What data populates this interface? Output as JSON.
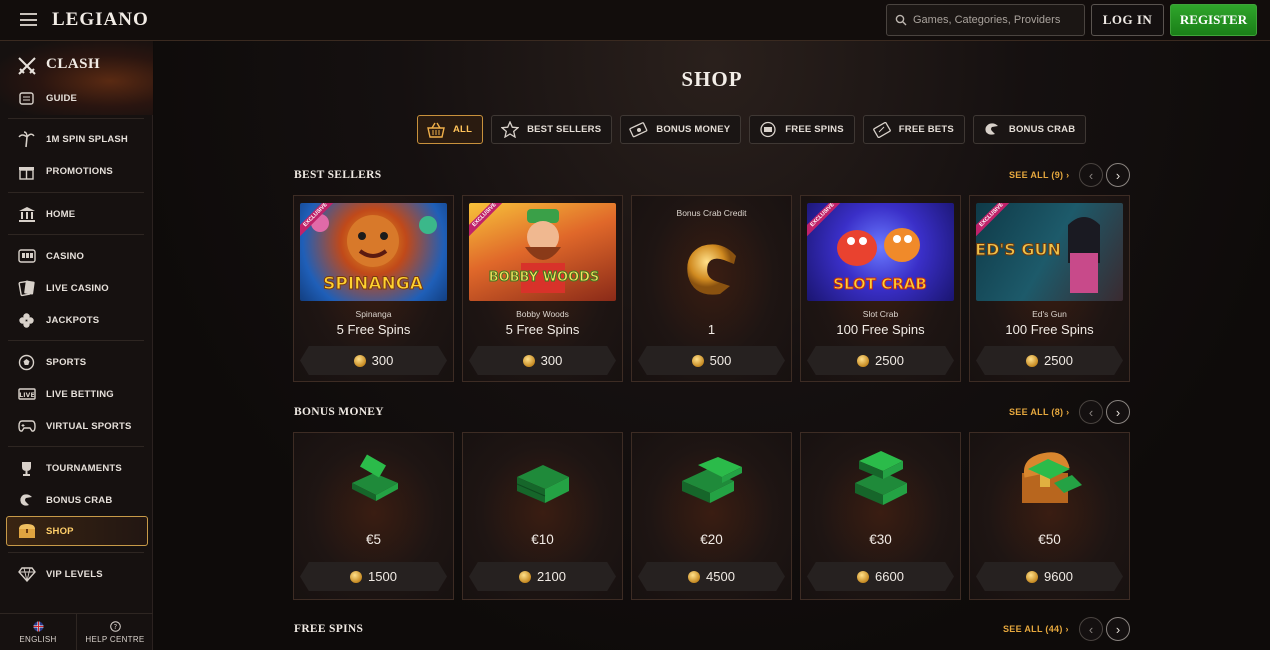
{
  "header": {
    "logo": "LEGIANO",
    "search_placeholder": "Games, Categories, Providers",
    "login_label": "LOG IN",
    "register_label": "REGISTER"
  },
  "sidebar": {
    "clash": "CLASH",
    "items": [
      {
        "label": "GUIDE",
        "icon": "scroll-icon"
      },
      {
        "label": "1M SPIN SPLASH",
        "icon": "palm-tree-icon"
      },
      {
        "label": "PROMOTIONS",
        "icon": "gift-icon"
      },
      {
        "label": "HOME",
        "icon": "temple-icon"
      },
      {
        "label": "CASINO",
        "icon": "slot-machine-icon"
      },
      {
        "label": "LIVE CASINO",
        "icon": "cards-icon"
      },
      {
        "label": "JACKPOTS",
        "icon": "clover-icon"
      },
      {
        "label": "SPORTS",
        "icon": "ball-icon"
      },
      {
        "label": "LIVE BETTING",
        "icon": "live-icon"
      },
      {
        "label": "VIRTUAL SPORTS",
        "icon": "gamepad-icon"
      },
      {
        "label": "TOURNAMENTS",
        "icon": "trophy-icon"
      },
      {
        "label": "BONUS CRAB",
        "icon": "crab-claw-icon"
      },
      {
        "label": "SHOP",
        "icon": "chest-icon"
      },
      {
        "label": "VIP LEVELS",
        "icon": "diamond-icon"
      }
    ],
    "language": "ENGLISH",
    "help": "HELP CENTRE"
  },
  "main": {
    "title": "SHOP",
    "filters": [
      {
        "label": "ALL",
        "icon": "basket-icon",
        "active": true
      },
      {
        "label": "BEST SELLERS",
        "icon": "star-icon",
        "active": false
      },
      {
        "label": "BONUS MONEY",
        "icon": "money-icon",
        "active": false
      },
      {
        "label": "FREE SPINS",
        "icon": "spins-icon",
        "active": false
      },
      {
        "label": "FREE BETS",
        "icon": "ticket-icon",
        "active": false
      },
      {
        "label": "BONUS CRAB",
        "icon": "crab-claw-icon",
        "active": false
      }
    ],
    "best_sellers": {
      "title": "BEST SELLERS",
      "see_all": "SEE ALL (9)",
      "cards": [
        {
          "game": "Spinanga",
          "reward": "5 Free Spins",
          "price": "300",
          "exclusive": true,
          "thumb_colors": [
            "#1f5fb8",
            "#e9a320"
          ],
          "thumb_text": "SPINANGA"
        },
        {
          "game": "Bobby Woods",
          "reward": "5 Free Spins",
          "price": "300",
          "exclusive": true,
          "thumb_colors": [
            "#b8531a",
            "#f7c23a"
          ],
          "thumb_text": "BOBBY WOODS"
        },
        {
          "game": "Bonus Crab Credit",
          "reward": "1",
          "price": "500",
          "exclusive": false
        },
        {
          "game": "Slot Crab",
          "reward": "100 Free Spins",
          "price": "2500",
          "exclusive": true,
          "thumb_colors": [
            "#2a2fa8",
            "#e9422f"
          ],
          "thumb_text": "SLOT CRAB"
        },
        {
          "game": "Ed's Gun",
          "reward": "100 Free Spins",
          "price": "2500",
          "exclusive": true,
          "thumb_colors": [
            "#1d5a6a",
            "#d8a43a"
          ],
          "thumb_text": "ED'S GUN"
        }
      ]
    },
    "bonus_money": {
      "title": "BONUS MONEY",
      "see_all": "SEE ALL (8)",
      "cards": [
        {
          "reward": "€5",
          "price": "1500"
        },
        {
          "reward": "€10",
          "price": "2100"
        },
        {
          "reward": "€20",
          "price": "4500"
        },
        {
          "reward": "€30",
          "price": "6600"
        },
        {
          "reward": "€50",
          "price": "9600"
        }
      ]
    },
    "free_spins": {
      "title": "FREE SPINS",
      "see_all": "SEE ALL (44)"
    },
    "exclusive_label": "EXCLUSIVE"
  },
  "colors": {
    "accent": "#e6a83e",
    "register_green": "#2fa52b",
    "background": "#0e0b0a"
  }
}
